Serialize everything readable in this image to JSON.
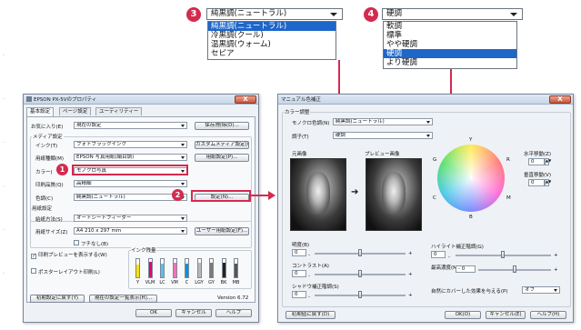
{
  "colors": {
    "accent_red": "#d42a4f",
    "select_blue": "#1e66c8",
    "ink_yellow": "#f7e300",
    "ink_vlm": "#e4007f",
    "ink_lc": "#58c2ec",
    "ink_vm": "#ff70b8",
    "ink_c": "#0096d6",
    "ink_lgy": "#b8b8b8",
    "ink_gy": "#7b7b7b",
    "ink_bk": "#222222",
    "ink_mb": "#555555"
  },
  "callouts": {
    "b1": "1",
    "b2": "2",
    "b3": "3",
    "b4": "4"
  },
  "dropdown3": {
    "selected": "純黒調(ニュートラル)",
    "items": [
      {
        "label": "純黒調(ニュートラル)",
        "selected": true
      },
      {
        "label": "冷黒調(クール)",
        "selected": false
      },
      {
        "label": "温黒調(ウォーム)",
        "selected": false
      },
      {
        "label": "セピア",
        "selected": false
      }
    ]
  },
  "dropdown4": {
    "selected": "硬調",
    "items": [
      {
        "label": "軟調",
        "selected": false
      },
      {
        "label": "標準",
        "selected": false
      },
      {
        "label": "やや硬調",
        "selected": false
      },
      {
        "label": "硬調",
        "selected": true
      },
      {
        "label": "より硬調",
        "selected": false
      }
    ]
  },
  "left_window": {
    "title": "EPSON PX-5Vのプロパティ",
    "close": "X",
    "tabs": [
      "基本設定",
      "ページ設定",
      "ユーティリティー"
    ],
    "favorites_label": "お気に入り(E)",
    "favorites_value": "現在の設定",
    "save_delete_btn": "保存/削除(D)...",
    "media_group": "メディア設定",
    "ink_label": "インク(T)",
    "ink_value": "フォトブラックインク",
    "custom_btn": "カスタムメディア設定(G)...",
    "paper_type_label": "用紙種類(M)",
    "paper_type_value": "EPSON 写真用紙(絹目調)",
    "paper_config_btn": "用紙設定(P)...",
    "color_label": "カラー(",
    "color_value": "モノクロ写真",
    "quality_label": "印刷品質(Q)",
    "quality_value": "高精細",
    "tone_label": "色調(C)",
    "tone_value": "純黒調(ニュートラル)",
    "settings_btn": "設定(N)...",
    "paper_group": "用紙設定",
    "feed_label": "給紙方法(S)",
    "feed_value": "オートシートフィーダー",
    "size_label": "用紙サイズ(Z)",
    "size_value": "A4 210 x 297 mm",
    "user_size_btn": "ユーザー用紙設定(F)...",
    "borderless_label": "フチなし(B)",
    "ink_level_label": "インク残量",
    "preview_label": "印刷プレビューを表示する(W)",
    "poster_label": "ポスターレイアウト印刷(L)",
    "ink_names": [
      "Y",
      "VLM",
      "LC",
      "VM",
      "C",
      "LGY",
      "GY",
      "BK",
      "MB"
    ],
    "ink_levels": [
      0.7,
      0.85,
      0.75,
      0.8,
      0.75,
      0.8,
      0.8,
      0.8,
      0.75
    ],
    "reset_btn": "初期設定に戻す(Y)",
    "list_btn": "現在の設定一覧表示(H)...",
    "version": "Version 6.72",
    "ok_btn": "OK",
    "cancel_btn": "キャンセル",
    "help_btn": "ヘルプ"
  },
  "right_window": {
    "title": "マニュアル色補正",
    "close": "X",
    "color_group": "カラー調整",
    "mono_tone_label": "モノクロ色調(N)",
    "mono_tone_value": "純黒調(ニュートラル)",
    "tone_label": "調子(T)",
    "tone_value": "硬調",
    "original_label": "元画像",
    "preview_label": "プレビュー画像",
    "arrow": "➔",
    "wheel_labels": {
      "y": "Y",
      "r": "R",
      "m": "M",
      "b": "B",
      "c": "C",
      "g": "G"
    },
    "h_move_label": "水平移動(Z)",
    "h_move_value": "0",
    "v_move_label": "垂直移動(V)",
    "v_move_value": "0",
    "brightness_label": "明度(B)",
    "brightness_value": "0",
    "contrast_label": "コントラスト(A)",
    "contrast_value": "0",
    "shadow_label": "シャドウ補正階調(S)",
    "shadow_value": "0",
    "highlight_label": "ハイライト補正階調(G)",
    "highlight_value": "0",
    "max_density_label": "最高濃度(M)",
    "max_density_value": "0",
    "effect_label": "自然にカバーした効果を与える(P)",
    "effect_value": "オフ",
    "reset_btn": "初期値に戻す(D)",
    "ok_btn": "OK(O)",
    "cancel_btn": "キャンセル(E)",
    "help_btn": "ヘルプ(H)",
    "minus": "-",
    "plus": "+"
  }
}
